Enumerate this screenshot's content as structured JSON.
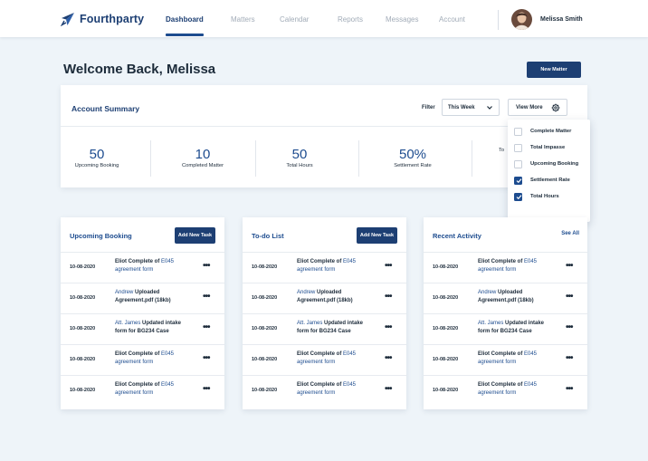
{
  "header": {
    "brand": "Fourthparty",
    "nav": [
      {
        "label": "Dashboard",
        "active": true
      },
      {
        "label": "Matters",
        "active": false
      },
      {
        "label": "Calendar",
        "active": false
      },
      {
        "label": "Reports",
        "active": false
      },
      {
        "label": "Messages",
        "active": false
      },
      {
        "label": "Account",
        "active": false
      }
    ],
    "user_name": "Melissa Smith",
    "brand_color": "#1d3f73"
  },
  "welcome": "Welcome Back, Melissa",
  "new_matter_label": "New Matter",
  "summary": {
    "title": "Account Summary",
    "filter_label": "Filter",
    "filter_value": "This Week",
    "view_more_label": "View More",
    "stats": [
      {
        "value": "50",
        "label": "Upcoming Booking"
      },
      {
        "value": "10",
        "label": "Completed Matter"
      },
      {
        "value": "50",
        "label": "Total Hours"
      },
      {
        "value": "50%",
        "label": "Settlement Rate"
      },
      {
        "value": "",
        "label": "To"
      }
    ]
  },
  "menu": {
    "items": [
      {
        "label": "Complete Matter",
        "checked": false
      },
      {
        "label": "Total Impasse",
        "checked": false
      },
      {
        "label": "Upcoming Booking",
        "checked": false
      },
      {
        "label": "Settlement Rate",
        "checked": true
      },
      {
        "label": "Total Hours",
        "checked": true
      }
    ]
  },
  "panels": [
    {
      "title": "Upcoming Booking",
      "button": "Add New Task",
      "rows": [
        {
          "date": "10-08-2020",
          "a": "Eliot Complete of ",
          "b": "E045",
          "c": "agreement form"
        },
        {
          "date": "10-08-2020",
          "a": "Andrew",
          "b": " Uploaded",
          "c": "Agreement.pdf (18kb)"
        },
        {
          "date": "10-08-2020",
          "a": "Att. James",
          "b": " Updated intake",
          "c": "form for BG234 Case"
        },
        {
          "date": "10-08-2020",
          "a": "Eliot Complete of ",
          "b": "E045",
          "c": "agreement form"
        },
        {
          "date": "10-08-2020",
          "a": "Eliot Complete of ",
          "b": "E045",
          "c": "agreement form"
        }
      ]
    },
    {
      "title": "To-do List",
      "button": "Add New Task",
      "rows": [
        {
          "date": "10-08-2020",
          "a": "Eliot Complete of ",
          "b": "E045",
          "c": "agreement form"
        },
        {
          "date": "10-08-2020",
          "a": "Andrew",
          "b": " Uploaded",
          "c": "Agreement.pdf (18kb)"
        },
        {
          "date": "10-08-2020",
          "a": "Att. James",
          "b": " Updated intake",
          "c": "form for BG234 Case"
        },
        {
          "date": "10-08-2020",
          "a": "Eliot Complete of ",
          "b": "E045",
          "c": "agreement form"
        },
        {
          "date": "10-08-2020",
          "a": "Eliot Complete of ",
          "b": "E045",
          "c": "agreement form"
        }
      ]
    },
    {
      "title": "Recent Activity",
      "see_all": "See All",
      "rows": [
        {
          "date": "10-08-2020",
          "a": "Eliot Complete of ",
          "b": "E045",
          "c": "agreement form"
        },
        {
          "date": "10-08-2020",
          "a": "Andrew",
          "b": " Uploaded",
          "c": "Agreement.pdf (18kb)"
        },
        {
          "date": "10-08-2020",
          "a": "Att. James",
          "b": " Updated intake",
          "c": "form for BG234 Case"
        },
        {
          "date": "10-08-2020",
          "a": "Eliot Complete of ",
          "b": "E045",
          "c": "agreement form"
        },
        {
          "date": "10-08-2020",
          "a": "Eliot Complete of ",
          "b": "E045",
          "c": "agreement form"
        }
      ]
    }
  ]
}
